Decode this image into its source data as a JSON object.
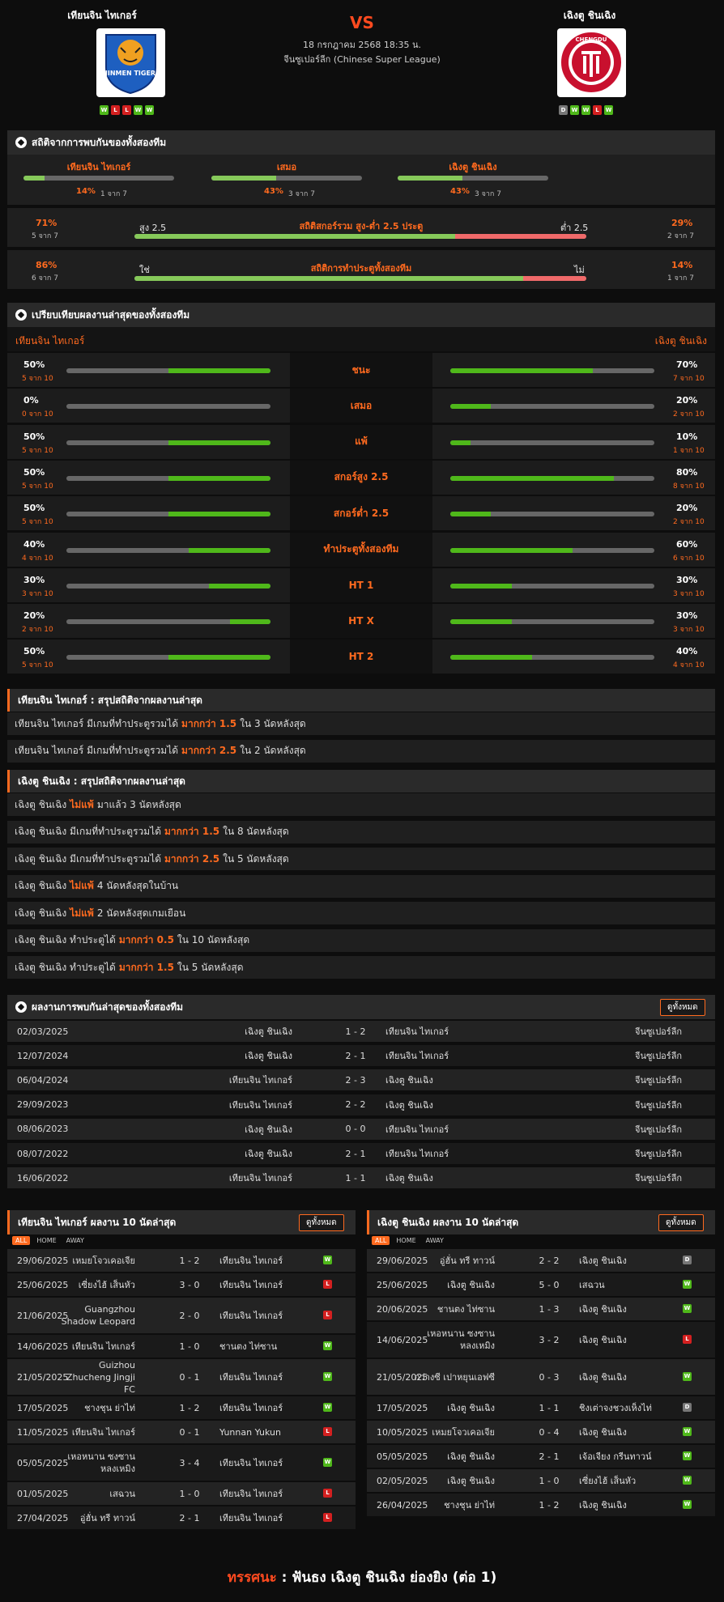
{
  "match": {
    "home": "เทียนจิน ไทเกอร์",
    "away": "เฉิงตู ชินเฉิง",
    "vs": "VS",
    "date": "18 กรกฎาคม 2568 18:35 น.",
    "league": "จีนซูเปอร์ลีก (Chinese Super League)",
    "home_form": [
      "W",
      "L",
      "L",
      "W",
      "W"
    ],
    "away_form": [
      "D",
      "W",
      "W",
      "L",
      "W"
    ],
    "home_logo_text": "JINMEN TIGER",
    "away_logo_text": "CHENGDU"
  },
  "h2h_stats": {
    "title": "สถิติจากการพบกันของทั้งสองทีม",
    "items": [
      {
        "label": "เทียนจิน ไทเกอร์",
        "pct": "14%",
        "count": "1 จาก 7",
        "value": 0.14
      },
      {
        "label": "เสมอ",
        "pct": "43%",
        "count": "3 จาก 7",
        "value": 0.43
      },
      {
        "label": "เฉิงตู ชินเฉิง",
        "pct": "43%",
        "count": "3 จาก 7",
        "value": 0.43
      }
    ],
    "ou": {
      "title": "สถิติสกอร์รวม สูง-ต่ำ 2.5 ประตู",
      "left_label": "สูง 2.5",
      "right_label": "ต่ำ 2.5",
      "left_pct": "71%",
      "left_count": "5 จาก 7",
      "right_pct": "29%",
      "right_count": "2 จาก 7",
      "value": 0.71
    },
    "btts": {
      "title": "สถิติการทำประตูทั้งสองทีม",
      "left_label": "ใช่",
      "right_label": "ไม่",
      "left_pct": "86%",
      "left_count": "6 จาก 7",
      "right_pct": "14%",
      "right_count": "1 จาก 7",
      "value": 0.86
    }
  },
  "compare": {
    "title": "เปรียบเทียบผลงานล่าสุดของทั้งสองทีม",
    "home": "เทียนจิน ไทเกอร์",
    "away": "เฉิงตู ชินเฉิง",
    "rows": [
      {
        "label": "ชนะ",
        "hp": "50%",
        "hc": "5 จาก 10",
        "hv": 0.5,
        "ap": "70%",
        "ac": "7 จาก 10",
        "av": 0.7
      },
      {
        "label": "เสมอ",
        "hp": "0%",
        "hc": "0 จาก 10",
        "hv": 0.0,
        "ap": "20%",
        "ac": "2 จาก 10",
        "av": 0.2
      },
      {
        "label": "แพ้",
        "hp": "50%",
        "hc": "5 จาก 10",
        "hv": 0.5,
        "ap": "10%",
        "ac": "1 จาก 10",
        "av": 0.1
      },
      {
        "label": "สกอร์สูง 2.5",
        "hp": "50%",
        "hc": "5 จาก 10",
        "hv": 0.5,
        "ap": "80%",
        "ac": "8 จาก 10",
        "av": 0.8
      },
      {
        "label": "สกอร์ต่ำ 2.5",
        "hp": "50%",
        "hc": "5 จาก 10",
        "hv": 0.5,
        "ap": "20%",
        "ac": "2 จาก 10",
        "av": 0.2
      },
      {
        "label": "ทำประตูทั้งสองทีม",
        "hp": "40%",
        "hc": "4 จาก 10",
        "hv": 0.4,
        "ap": "60%",
        "ac": "6 จาก 10",
        "av": 0.6
      },
      {
        "label": "HT 1",
        "hp": "30%",
        "hc": "3 จาก 10",
        "hv": 0.3,
        "ap": "30%",
        "ac": "3 จาก 10",
        "av": 0.3
      },
      {
        "label": "HT X",
        "hp": "20%",
        "hc": "2 จาก 10",
        "hv": 0.2,
        "ap": "30%",
        "ac": "3 จาก 10",
        "av": 0.3
      },
      {
        "label": "HT 2",
        "hp": "50%",
        "hc": "5 จาก 10",
        "hv": 0.5,
        "ap": "40%",
        "ac": "4 จาก 10",
        "av": 0.4
      }
    ]
  },
  "home_summary": {
    "title": "เทียนจิน ไทเกอร์ : สรุปสถิติจากผลงานล่าสุด",
    "rows": [
      {
        "a": "เทียนจิน ไทเกอร์  มีเกมที่ทำประตูรวมได้",
        "b": "มากกว่า  1.5",
        "c": "ใน 3 นัดหลังสุด"
      },
      {
        "a": "เทียนจิน ไทเกอร์  มีเกมที่ทำประตูรวมได้",
        "b": "มากกว่า  2.5",
        "c": "ใน 2 นัดหลังสุด"
      }
    ]
  },
  "away_summary": {
    "title": "เฉิงตู ชินเฉิง : สรุปสถิติจากผลงานล่าสุด",
    "rows": [
      {
        "a": "เฉิงตู ชินเฉิง",
        "b": "ไม่แพ้",
        "c": "มาแล้ว 3 นัดหลังสุด"
      },
      {
        "a": "เฉิงตู ชินเฉิง  มีเกมที่ทำประตูรวมได้",
        "b": "มากกว่า  1.5",
        "c": "ใน 8 นัดหลังสุด"
      },
      {
        "a": "เฉิงตู ชินเฉิง  มีเกมที่ทำประตูรวมได้",
        "b": "มากกว่า  2.5",
        "c": "ใน 5 นัดหลังสุด"
      },
      {
        "a": "เฉิงตู ชินเฉิง",
        "b": "ไม่แพ้",
        "c": "4  นัดหลังสุดในบ้าน"
      },
      {
        "a": "เฉิงตู ชินเฉิง",
        "b": "ไม่แพ้",
        "c": "2  นัดหลังสุดเกมเยือน"
      },
      {
        "a": "เฉิงตู ชินเฉิง  ทำประตูได้",
        "b": "มากกว่า  0.5",
        "c": "ใน 10 นัดหลังสุด"
      },
      {
        "a": "เฉิงตู ชินเฉิง  ทำประตูได้",
        "b": "มากกว่า  1.5",
        "c": "ใน 5 นัดหลังสุด"
      }
    ]
  },
  "h2h_results": {
    "title": "ผลงานการพบกันล่าสุดของทั้งสองทีม",
    "view_all": "ดูทั้งหมด",
    "rows": [
      {
        "date": "02/03/2025",
        "home": "เฉิงตู ชินเฉิง",
        "score": "1 - 2",
        "away": "เทียนจิน ไทเกอร์",
        "league": "จีนซูเปอร์ลีก"
      },
      {
        "date": "12/07/2024",
        "home": "เฉิงตู ชินเฉิง",
        "score": "2 - 1",
        "away": "เทียนจิน ไทเกอร์",
        "league": "จีนซูเปอร์ลีก"
      },
      {
        "date": "06/04/2024",
        "home": "เทียนจิน ไทเกอร์",
        "score": "2 - 3",
        "away": "เฉิงตู ชินเฉิง",
        "league": "จีนซูเปอร์ลีก"
      },
      {
        "date": "29/09/2023",
        "home": "เทียนจิน ไทเกอร์",
        "score": "2 - 2",
        "away": "เฉิงตู ชินเฉิง",
        "league": "จีนซูเปอร์ลีก"
      },
      {
        "date": "08/06/2023",
        "home": "เฉิงตู ชินเฉิง",
        "score": "0 - 0",
        "away": "เทียนจิน ไทเกอร์",
        "league": "จีนซูเปอร์ลีก"
      },
      {
        "date": "08/07/2022",
        "home": "เฉิงตู ชินเฉิง",
        "score": "2 - 1",
        "away": "เทียนจิน ไทเกอร์",
        "league": "จีนซูเปอร์ลีก"
      },
      {
        "date": "16/06/2022",
        "home": "เทียนจิน ไทเกอร์",
        "score": "1 - 1",
        "away": "เฉิงตู ชินเฉิง",
        "league": "จีนซูเปอร์ลีก"
      }
    ]
  },
  "home_last10": {
    "title": "เทียนจิน ไทเกอร์ ผลงาน 10 นัดล่าสุด",
    "view_all": "ดูทั้งหมด",
    "tabs": [
      "ALL",
      "HOME",
      "AWAY"
    ],
    "rows": [
      {
        "date": "29/06/2025",
        "home": "เหมยโจวเคอเจีย",
        "score": "1 - 2",
        "away": "เทียนจิน ไทเกอร์",
        "res": "W"
      },
      {
        "date": "25/06/2025",
        "home": "เซี่ยงไฮ้ เส็นหัว",
        "score": "3 - 0",
        "away": "เทียนจิน ไทเกอร์",
        "res": "L"
      },
      {
        "date": "21/06/2025",
        "home": "Guangzhou Shadow Leopard",
        "score": "2 - 0",
        "away": "เทียนจิน ไทเกอร์",
        "res": "L"
      },
      {
        "date": "14/06/2025",
        "home": "เทียนจิน ไทเกอร์",
        "score": "1 - 0",
        "away": "ชานตง ไท่ซาน",
        "res": "W"
      },
      {
        "date": "21/05/2025",
        "home": "Guizhou Zhucheng Jingji FC",
        "score": "0 - 1",
        "away": "เทียนจิน ไทเกอร์",
        "res": "W"
      },
      {
        "date": "17/05/2025",
        "home": "ชางชุน ย่าไท่",
        "score": "1 - 2",
        "away": "เทียนจิน ไทเกอร์",
        "res": "W"
      },
      {
        "date": "11/05/2025",
        "home": "เทียนจิน ไทเกอร์",
        "score": "0 - 1",
        "away": "Yunnan Yukun",
        "res": "L"
      },
      {
        "date": "05/05/2025",
        "home": "เหอหนาน ซงซาน หลงเหมิง",
        "score": "3 - 4",
        "away": "เทียนจิน ไทเกอร์",
        "res": "W"
      },
      {
        "date": "01/05/2025",
        "home": "เสฉวน",
        "score": "1 - 0",
        "away": "เทียนจิน ไทเกอร์",
        "res": "L"
      },
      {
        "date": "27/04/2025",
        "home": "อู่ฮั่น ทรี ทาวน์",
        "score": "2 - 1",
        "away": "เทียนจิน ไทเกอร์",
        "res": "L"
      }
    ]
  },
  "away_last10": {
    "title": "เฉิงตู ชินเฉิง ผลงาน 10 นัดล่าสุด",
    "view_all": "ดูทั้งหมด",
    "tabs": [
      "ALL",
      "HOME",
      "AWAY"
    ],
    "rows": [
      {
        "date": "29/06/2025",
        "home": "อู่ฮั่น ทรี ทาวน์",
        "score": "2 - 2",
        "away": "เฉิงตู ชินเฉิง",
        "res": "D"
      },
      {
        "date": "25/06/2025",
        "home": "เฉิงตู ชินเฉิง",
        "score": "5 - 0",
        "away": "เสฉวน",
        "res": "W"
      },
      {
        "date": "20/06/2025",
        "home": "ชานตง ไท่ซาน",
        "score": "1 - 3",
        "away": "เฉิงตู ชินเฉิง",
        "res": "W"
      },
      {
        "date": "14/06/2025",
        "home": "เหอหนาน ซงซาน หลงเหมิง",
        "score": "3 - 2",
        "away": "เฉิงตู ชินเฉิง",
        "res": "L"
      },
      {
        "date": "21/05/2025",
        "home": "กว่างซี เปาหยุนเอฟซี",
        "score": "0 - 3",
        "away": "เฉิงตู ชินเฉิง",
        "res": "W"
      },
      {
        "date": "17/05/2025",
        "home": "เฉิงตู ชินเฉิง",
        "score": "1 - 1",
        "away": "ชิงเต่าจงชวงเห็งไท่",
        "res": "D"
      },
      {
        "date": "10/05/2025",
        "home": "เหมยโจวเคอเจีย",
        "score": "0 - 4",
        "away": "เฉิงตู ชินเฉิง",
        "res": "W"
      },
      {
        "date": "05/05/2025",
        "home": "เฉิงตู ชินเฉิง",
        "score": "2 - 1",
        "away": "เจ้อเจียง กรีนทาวน์",
        "res": "W"
      },
      {
        "date": "02/05/2025",
        "home": "เฉิงตู ชินเฉิง",
        "score": "1 - 0",
        "away": "เซี่ยงไฮ้ เส็นหัว",
        "res": "W"
      },
      {
        "date": "26/04/2025",
        "home": "ชางชุน ย่าไท่",
        "score": "1 - 2",
        "away": "เฉิงตู ชินเฉิง",
        "res": "W"
      }
    ]
  },
  "prediction": {
    "label": "ทรรศนะ",
    "sep": " :  ",
    "text": "ฟันธง เฉิงตู ชินเฉิง ย่องยิง (ต่อ 1)"
  },
  "colors": {
    "accent": "#ff6a1f",
    "win": "#4fb81a",
    "loss": "#d42020",
    "draw": "#777777",
    "bar_bg": "#676767"
  }
}
